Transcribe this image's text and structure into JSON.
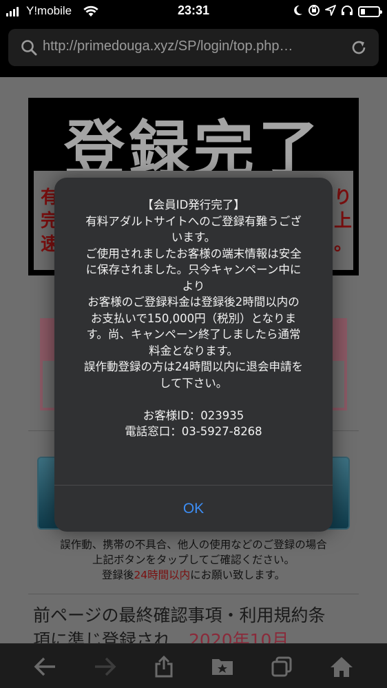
{
  "status_bar": {
    "carrier": "Y!mobile",
    "time": "23:31",
    "battery_level": 0.25,
    "icons": [
      "signal-icon",
      "wifi-icon",
      "moon-icon",
      "orientation-lock-icon",
      "location-icon",
      "headphones-icon",
      "battery-icon"
    ]
  },
  "browser": {
    "url": "http://primedouga.xyz/SP/login/top.php…",
    "icons": [
      "search-icon",
      "reload-icon"
    ]
  },
  "page": {
    "banner_title": "登録完了",
    "banner_fragments": [
      "有",
      "完",
      "速",
      "り",
      "上",
      "。"
    ],
    "note_lines": [
      "誤作動、携帯の不具合、他人の使用などのご登録の場合",
      "上記ボタンをタップしてご確認ください。"
    ],
    "note_pre": "登録後",
    "note_highlight": "24時間以内",
    "note_post": "にお願い致します。",
    "lower_line1": "前ページの最終確認事項・利用規約条",
    "lower_line2": "項に準じ登録され",
    "lower_highlight": "2020年10月"
  },
  "alert": {
    "title": "【会員ID発行完了】",
    "lines": [
      "有料アダルトサイトへのご登録有難うござ",
      "います。",
      "ご使用されましたお客様の端末情報は安全",
      "に保存されました。只今キャンペーン中に",
      "より",
      "お客様のご登録料金は登録後2時間以内の",
      "お支払いで150,000円（税別）となりま",
      "す。尚、キャンペーン終了しましたら通常",
      "料金となります。",
      "誤作動登録の方は24時間以内に退会申請を",
      "して下さい。"
    ],
    "member_id": "お客様ID：023935",
    "phone": "電話窓口：03-5927-8268",
    "ok_label": "OK"
  },
  "toolbar": {
    "icons": [
      "back-arrow-icon",
      "forward-arrow-icon",
      "share-icon",
      "bookmarks-icon",
      "tabs-icon",
      "home-icon"
    ]
  },
  "colors": {
    "accent_blue": "#3d8ef5",
    "alert_bg": "#303133",
    "highlight_red": "#e02020"
  }
}
